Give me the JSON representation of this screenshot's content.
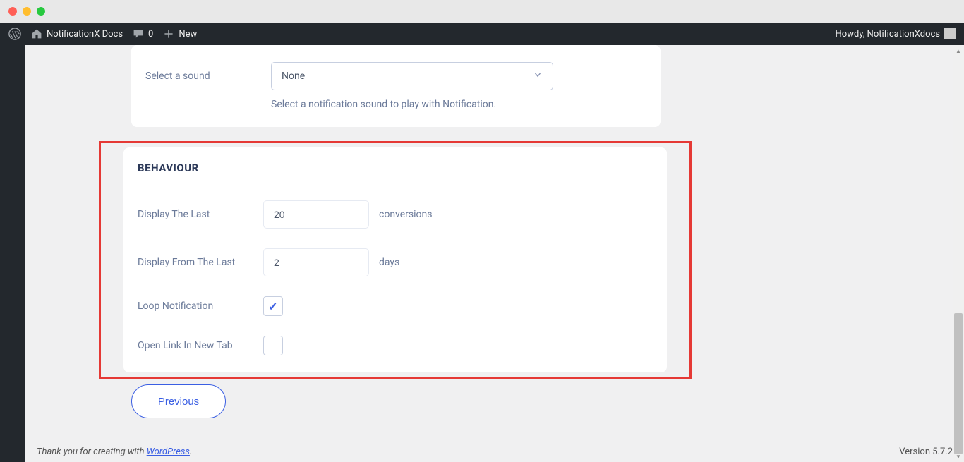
{
  "wpbar": {
    "site_name": "NotificationX Docs",
    "comments_count": "0",
    "new_label": "New",
    "howdy_text": "Howdy, NotificationXdocs"
  },
  "sound_section": {
    "label": "Select a sound",
    "selected": "None",
    "help_text": "Select a notification sound to play with Notification."
  },
  "behaviour": {
    "title": "BEHAVIOUR",
    "display_last": {
      "label": "Display The Last",
      "value": "20",
      "suffix": "conversions"
    },
    "display_from": {
      "label": "Display From The Last",
      "value": "2",
      "suffix": "days"
    },
    "loop_notification": {
      "label": "Loop Notification",
      "checked": true
    },
    "open_new_tab": {
      "label": "Open Link In New Tab",
      "checked": false
    }
  },
  "nav": {
    "previous": "Previous"
  },
  "footer": {
    "thank_you_prefix": "Thank you for creating with ",
    "wp_link": "WordPress",
    "thank_you_suffix": ".",
    "version": "Version 5.7.2"
  }
}
